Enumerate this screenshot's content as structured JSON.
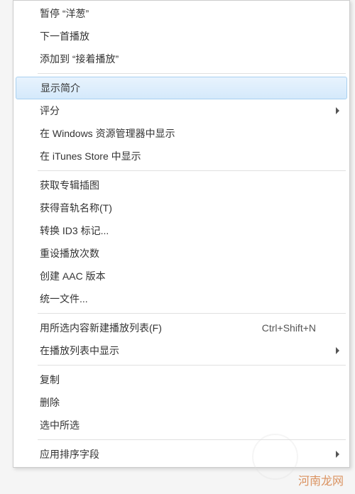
{
  "menu": {
    "groups": [
      [
        {
          "id": "pause-onion",
          "label": "暂停 “洋葱”",
          "hasSubmenu": false,
          "highlighted": false,
          "shortcut": ""
        },
        {
          "id": "play-next",
          "label": "下一首播放",
          "hasSubmenu": false,
          "highlighted": false,
          "shortcut": ""
        },
        {
          "id": "add-to-up-next",
          "label": "添加到 “接着播放”",
          "hasSubmenu": false,
          "highlighted": false,
          "shortcut": ""
        }
      ],
      [
        {
          "id": "get-info",
          "label": "显示简介",
          "hasSubmenu": false,
          "highlighted": true,
          "shortcut": ""
        },
        {
          "id": "rating",
          "label": "评分",
          "hasSubmenu": true,
          "highlighted": false,
          "shortcut": ""
        },
        {
          "id": "show-in-explorer",
          "label": "在 Windows 资源管理器中显示",
          "hasSubmenu": false,
          "highlighted": false,
          "shortcut": ""
        },
        {
          "id": "show-in-store",
          "label": "在 iTunes Store 中显示",
          "hasSubmenu": false,
          "highlighted": false,
          "shortcut": ""
        }
      ],
      [
        {
          "id": "get-album-art",
          "label": "获取专辑插图",
          "hasSubmenu": false,
          "highlighted": false,
          "shortcut": ""
        },
        {
          "id": "get-track-names",
          "label": "获得音轨名称(T)",
          "hasSubmenu": false,
          "highlighted": false,
          "shortcut": ""
        },
        {
          "id": "convert-id3",
          "label": "转换 ID3 标记...",
          "hasSubmenu": false,
          "highlighted": false,
          "shortcut": ""
        },
        {
          "id": "reset-play-count",
          "label": "重设播放次数",
          "hasSubmenu": false,
          "highlighted": false,
          "shortcut": ""
        },
        {
          "id": "create-aac",
          "label": "创建 AAC 版本",
          "hasSubmenu": false,
          "highlighted": false,
          "shortcut": ""
        },
        {
          "id": "consolidate-files",
          "label": "统一文件...",
          "hasSubmenu": false,
          "highlighted": false,
          "shortcut": ""
        }
      ],
      [
        {
          "id": "new-playlist-selection",
          "label": "用所选内容新建播放列表(F)",
          "hasSubmenu": false,
          "highlighted": false,
          "shortcut": "Ctrl+Shift+N"
        },
        {
          "id": "show-in-playlist",
          "label": "在播放列表中显示",
          "hasSubmenu": true,
          "highlighted": false,
          "shortcut": ""
        }
      ],
      [
        {
          "id": "copy",
          "label": "复制",
          "hasSubmenu": false,
          "highlighted": false,
          "shortcut": ""
        },
        {
          "id": "delete",
          "label": "删除",
          "hasSubmenu": false,
          "highlighted": false,
          "shortcut": ""
        },
        {
          "id": "uncheck-selection",
          "label": "选中所选",
          "hasSubmenu": false,
          "highlighted": false,
          "shortcut": ""
        }
      ],
      [
        {
          "id": "apply-sort-field",
          "label": "应用排序字段",
          "hasSubmenu": true,
          "highlighted": false,
          "shortcut": ""
        }
      ]
    ]
  },
  "watermark": "河南龙网"
}
